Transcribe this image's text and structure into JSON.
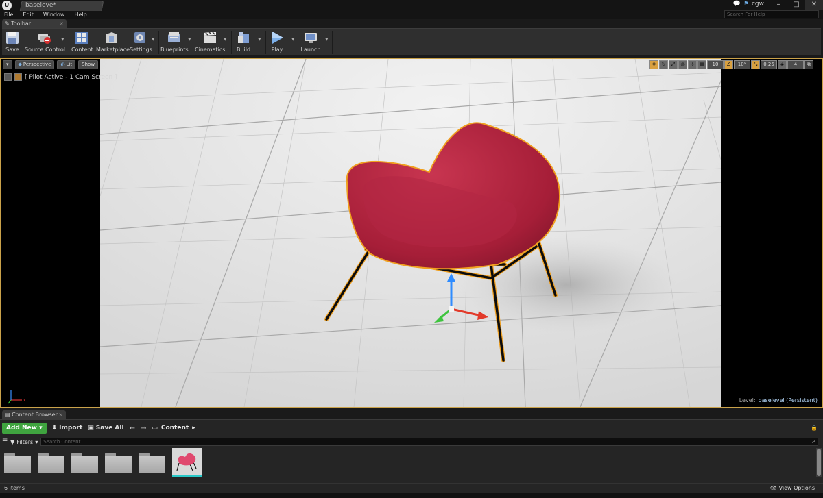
{
  "window": {
    "level_tab": "baseleve*",
    "user": "cgw",
    "search_help_placeholder": "Search For Help",
    "minimize": "–",
    "maximize": "□",
    "close": "✕"
  },
  "menu": [
    "File",
    "Edit",
    "Window",
    "Help"
  ],
  "toolbar_tab": {
    "label": "Toolbar"
  },
  "toolbar": [
    {
      "label": "Save",
      "icon": "save-icon"
    },
    {
      "label": "Source Control",
      "icon": "source-control-icon"
    },
    {
      "label": "Content",
      "icon": "content-icon"
    },
    {
      "label": "Marketplace",
      "icon": "marketplace-icon"
    },
    {
      "label": "Settings",
      "icon": "settings-icon"
    },
    {
      "label": "Blueprints",
      "icon": "blueprints-icon"
    },
    {
      "label": "Cinematics",
      "icon": "cinematics-icon"
    },
    {
      "label": "Build",
      "icon": "build-icon"
    },
    {
      "label": "Play",
      "icon": "play-icon"
    },
    {
      "label": "Launch",
      "icon": "launch-icon"
    }
  ],
  "viewport": {
    "perspective": "Perspective",
    "lit": "Lit",
    "show": "Show",
    "pilot_label": "[ Pilot Active - 1 Cam Screen ]",
    "grid_snap": "10",
    "rotation_snap": "10°",
    "scale_snap": "0.25",
    "camera_speed": "4",
    "level_prefix": "Level:",
    "level_name": "baselevel (Persistent)"
  },
  "content_browser": {
    "tab_label": "Content Browser",
    "add_new": "Add New",
    "import": "Import",
    "save_all": "Save All",
    "path_root": "Content",
    "filters": "Filters",
    "search_placeholder": "Search Content",
    "item_count": "6 items",
    "view_options": "View Options",
    "folders": 5,
    "assets": [
      "chair-thumbnail"
    ]
  },
  "colors": {
    "selection_outline": "#f0a020",
    "chair_red": "#b5243f",
    "add_new_green": "#3fa43f",
    "floor": "#e4e4e4"
  }
}
